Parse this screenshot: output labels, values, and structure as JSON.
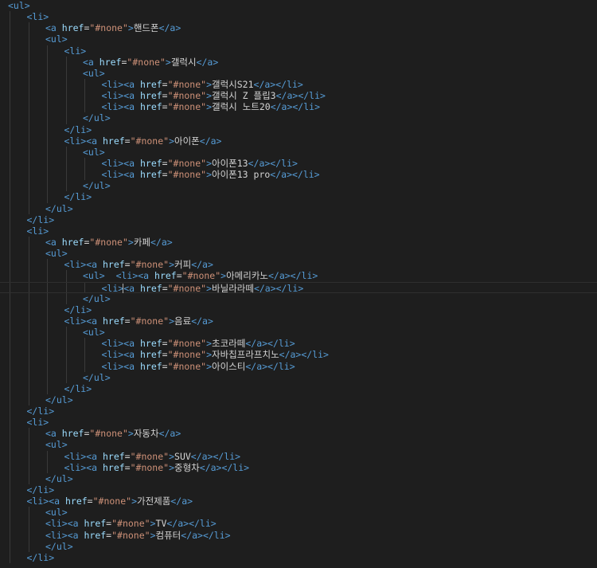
{
  "editor": {
    "language": "html",
    "theme": "dark",
    "lines": [
      {
        "indent": 0,
        "parts": [
          [
            "tag",
            "<ul>"
          ]
        ]
      },
      {
        "indent": 1,
        "parts": [
          [
            "tag",
            "<li>"
          ]
        ]
      },
      {
        "indent": 2,
        "parts": [
          [
            "tag",
            "<a "
          ],
          [
            "attr",
            "href"
          ],
          [
            "eq",
            "="
          ],
          [
            "val",
            "\"#none\""
          ],
          [
            "tag",
            ">"
          ],
          [
            "text",
            "핸드폰"
          ],
          [
            "tag",
            "</a>"
          ]
        ]
      },
      {
        "indent": 2,
        "parts": [
          [
            "tag",
            "<ul>"
          ]
        ]
      },
      {
        "indent": 3,
        "parts": [
          [
            "tag",
            "<li>"
          ]
        ]
      },
      {
        "indent": 4,
        "parts": [
          [
            "tag",
            "<a "
          ],
          [
            "attr",
            "href"
          ],
          [
            "eq",
            "="
          ],
          [
            "val",
            "\"#none\""
          ],
          [
            "tag",
            ">"
          ],
          [
            "text",
            "갤럭시"
          ],
          [
            "tag",
            "</a>"
          ]
        ]
      },
      {
        "indent": 4,
        "parts": [
          [
            "tag",
            "<ul>"
          ]
        ]
      },
      {
        "indent": 5,
        "parts": [
          [
            "tag",
            "<li><a "
          ],
          [
            "attr",
            "href"
          ],
          [
            "eq",
            "="
          ],
          [
            "val",
            "\"#none\""
          ],
          [
            "tag",
            ">"
          ],
          [
            "text",
            "갤럭시S21"
          ],
          [
            "tag",
            "</a></li>"
          ]
        ]
      },
      {
        "indent": 5,
        "parts": [
          [
            "tag",
            "<li><a "
          ],
          [
            "attr",
            "href"
          ],
          [
            "eq",
            "="
          ],
          [
            "val",
            "\"#none\""
          ],
          [
            "tag",
            ">"
          ],
          [
            "text",
            "갤럭시 Z 플립3"
          ],
          [
            "tag",
            "</a></li>"
          ]
        ]
      },
      {
        "indent": 5,
        "parts": [
          [
            "tag",
            "<li><a "
          ],
          [
            "attr",
            "href"
          ],
          [
            "eq",
            "="
          ],
          [
            "val",
            "\"#none\""
          ],
          [
            "tag",
            ">"
          ],
          [
            "text",
            "갤럭시 노트20"
          ],
          [
            "tag",
            "</a></li>"
          ]
        ]
      },
      {
        "indent": 4,
        "parts": [
          [
            "tag",
            "</ul>"
          ]
        ]
      },
      {
        "indent": 3,
        "parts": [
          [
            "tag",
            "</li>"
          ]
        ]
      },
      {
        "indent": 3,
        "parts": [
          [
            "tag",
            "<li><a "
          ],
          [
            "attr",
            "href"
          ],
          [
            "eq",
            "="
          ],
          [
            "val",
            "\"#none\""
          ],
          [
            "tag",
            ">"
          ],
          [
            "text",
            "아이폰"
          ],
          [
            "tag",
            "</a>"
          ]
        ]
      },
      {
        "indent": 4,
        "parts": [
          [
            "tag",
            "<ul>"
          ]
        ]
      },
      {
        "indent": 5,
        "parts": [
          [
            "tag",
            "<li><a "
          ],
          [
            "attr",
            "href"
          ],
          [
            "eq",
            "="
          ],
          [
            "val",
            "\"#none\""
          ],
          [
            "tag",
            ">"
          ],
          [
            "text",
            "아이폰13"
          ],
          [
            "tag",
            "</a></li>"
          ]
        ]
      },
      {
        "indent": 5,
        "parts": [
          [
            "tag",
            "<li><a "
          ],
          [
            "attr",
            "href"
          ],
          [
            "eq",
            "="
          ],
          [
            "val",
            "\"#none\""
          ],
          [
            "tag",
            ">"
          ],
          [
            "text",
            "아이폰13 pro"
          ],
          [
            "tag",
            "</a></li>"
          ]
        ]
      },
      {
        "indent": 4,
        "parts": [
          [
            "tag",
            "</ul>"
          ]
        ]
      },
      {
        "indent": 3,
        "parts": [
          [
            "tag",
            "</li>"
          ]
        ]
      },
      {
        "indent": 2,
        "parts": [
          [
            "tag",
            "</ul>"
          ]
        ]
      },
      {
        "indent": 1,
        "parts": [
          [
            "tag",
            "</li>"
          ]
        ]
      },
      {
        "indent": 1,
        "parts": [
          [
            "tag",
            "<li>"
          ]
        ]
      },
      {
        "indent": 2,
        "parts": [
          [
            "tag",
            "<a "
          ],
          [
            "attr",
            "href"
          ],
          [
            "eq",
            "="
          ],
          [
            "val",
            "\"#none\""
          ],
          [
            "tag",
            ">"
          ],
          [
            "text",
            "카페"
          ],
          [
            "tag",
            "</a>"
          ]
        ]
      },
      {
        "indent": 2,
        "parts": [
          [
            "tag",
            "<ul>"
          ]
        ]
      },
      {
        "indent": 3,
        "parts": [
          [
            "tag",
            "<li><a "
          ],
          [
            "attr",
            "href"
          ],
          [
            "eq",
            "="
          ],
          [
            "val",
            "\"#none\""
          ],
          [
            "tag",
            ">"
          ],
          [
            "text",
            "커피"
          ],
          [
            "tag",
            "</a>"
          ]
        ]
      },
      {
        "indent": 4,
        "parts": [
          [
            "tag",
            "<ul>"
          ],
          [
            "text",
            "  "
          ],
          [
            "tag",
            "<li><a "
          ],
          [
            "attr",
            "href"
          ],
          [
            "eq",
            "="
          ],
          [
            "val",
            "\"#none\""
          ],
          [
            "tag",
            ">"
          ],
          [
            "text",
            "아메리카노"
          ],
          [
            "tag",
            "</a></li>"
          ]
        ]
      },
      {
        "indent": 5,
        "current": true,
        "parts": [
          [
            "tag",
            "<li>"
          ],
          [
            "cursor",
            ""
          ],
          [
            "tag",
            "<a "
          ],
          [
            "attr",
            "href"
          ],
          [
            "eq",
            "="
          ],
          [
            "val",
            "\"#none\""
          ],
          [
            "tag",
            ">"
          ],
          [
            "text",
            "바닐라라떼"
          ],
          [
            "tag",
            "</a></li>"
          ]
        ]
      },
      {
        "indent": 4,
        "parts": [
          [
            "tag",
            "</ul>"
          ]
        ]
      },
      {
        "indent": 3,
        "parts": [
          [
            "tag",
            "</li>"
          ]
        ]
      },
      {
        "indent": 3,
        "parts": [
          [
            "tag",
            "<li><a "
          ],
          [
            "attr",
            "href"
          ],
          [
            "eq",
            "="
          ],
          [
            "val",
            "\"#none\""
          ],
          [
            "tag",
            ">"
          ],
          [
            "text",
            "음료"
          ],
          [
            "tag",
            "</a>"
          ]
        ]
      },
      {
        "indent": 4,
        "parts": [
          [
            "tag",
            "<ul>"
          ]
        ]
      },
      {
        "indent": 5,
        "parts": [
          [
            "tag",
            "<li><a "
          ],
          [
            "attr",
            "href"
          ],
          [
            "eq",
            "="
          ],
          [
            "val",
            "\"#none\""
          ],
          [
            "tag",
            ">"
          ],
          [
            "text",
            "초코라떼"
          ],
          [
            "tag",
            "</a></li>"
          ]
        ]
      },
      {
        "indent": 5,
        "parts": [
          [
            "tag",
            "<li><a "
          ],
          [
            "attr",
            "href"
          ],
          [
            "eq",
            "="
          ],
          [
            "val",
            "\"#none\""
          ],
          [
            "tag",
            ">"
          ],
          [
            "text",
            "자바칩프라프치노"
          ],
          [
            "tag",
            "</a></li>"
          ]
        ]
      },
      {
        "indent": 5,
        "parts": [
          [
            "tag",
            "<li><a "
          ],
          [
            "attr",
            "href"
          ],
          [
            "eq",
            "="
          ],
          [
            "val",
            "\"#none\""
          ],
          [
            "tag",
            ">"
          ],
          [
            "text",
            "아이스티"
          ],
          [
            "tag",
            "</a></li>"
          ]
        ]
      },
      {
        "indent": 4,
        "parts": [
          [
            "tag",
            "</ul>"
          ]
        ]
      },
      {
        "indent": 3,
        "parts": [
          [
            "tag",
            "</li>"
          ]
        ]
      },
      {
        "indent": 2,
        "parts": [
          [
            "tag",
            "</ul>"
          ]
        ]
      },
      {
        "indent": 1,
        "parts": [
          [
            "tag",
            "</li>"
          ]
        ]
      },
      {
        "indent": 1,
        "parts": [
          [
            "tag",
            "<li>"
          ]
        ]
      },
      {
        "indent": 2,
        "parts": [
          [
            "tag",
            "<a "
          ],
          [
            "attr",
            "href"
          ],
          [
            "eq",
            "="
          ],
          [
            "val",
            "\"#none\""
          ],
          [
            "tag",
            ">"
          ],
          [
            "text",
            "자동차"
          ],
          [
            "tag",
            "</a>"
          ]
        ]
      },
      {
        "indent": 2,
        "parts": [
          [
            "tag",
            "<ul>"
          ]
        ]
      },
      {
        "indent": 3,
        "parts": [
          [
            "tag",
            "<li><a "
          ],
          [
            "attr",
            "href"
          ],
          [
            "eq",
            "="
          ],
          [
            "val",
            "\"#none\""
          ],
          [
            "tag",
            ">"
          ],
          [
            "text",
            "SUV"
          ],
          [
            "tag",
            "</a></li>"
          ]
        ]
      },
      {
        "indent": 3,
        "parts": [
          [
            "tag",
            "<li><a "
          ],
          [
            "attr",
            "href"
          ],
          [
            "eq",
            "="
          ],
          [
            "val",
            "\"#none\""
          ],
          [
            "tag",
            ">"
          ],
          [
            "text",
            "중형차"
          ],
          [
            "tag",
            "</a></li>"
          ]
        ]
      },
      {
        "indent": 2,
        "parts": [
          [
            "tag",
            "</ul>"
          ]
        ]
      },
      {
        "indent": 1,
        "parts": [
          [
            "tag",
            "</li>"
          ]
        ]
      },
      {
        "indent": 1,
        "parts": [
          [
            "tag",
            "<li><a "
          ],
          [
            "attr",
            "href"
          ],
          [
            "eq",
            "="
          ],
          [
            "val",
            "\"#none\""
          ],
          [
            "tag",
            ">"
          ],
          [
            "text",
            "가전제품"
          ],
          [
            "tag",
            "</a>"
          ]
        ]
      },
      {
        "indent": 2,
        "parts": [
          [
            "tag",
            "<ul>"
          ]
        ]
      },
      {
        "indent": 2,
        "parts": [
          [
            "tag",
            "<li><a "
          ],
          [
            "attr",
            "href"
          ],
          [
            "eq",
            "="
          ],
          [
            "val",
            "\"#none\""
          ],
          [
            "tag",
            ">"
          ],
          [
            "text",
            "TV"
          ],
          [
            "tag",
            "</a></li>"
          ]
        ]
      },
      {
        "indent": 2,
        "parts": [
          [
            "tag",
            "<li><a "
          ],
          [
            "attr",
            "href"
          ],
          [
            "eq",
            "="
          ],
          [
            "val",
            "\"#none\""
          ],
          [
            "tag",
            ">"
          ],
          [
            "text",
            "컴퓨터"
          ],
          [
            "tag",
            "</a></li>"
          ]
        ]
      },
      {
        "indent": 2,
        "parts": [
          [
            "tag",
            "</ul>"
          ]
        ]
      },
      {
        "indent": 1,
        "parts": [
          [
            "tag",
            "</li>"
          ]
        ]
      }
    ]
  },
  "colors": {
    "background": "#1e1e1e",
    "tag": "#569cd6",
    "attribute": "#9cdcfe",
    "string": "#ce9178",
    "text": "#d4d4d4"
  }
}
